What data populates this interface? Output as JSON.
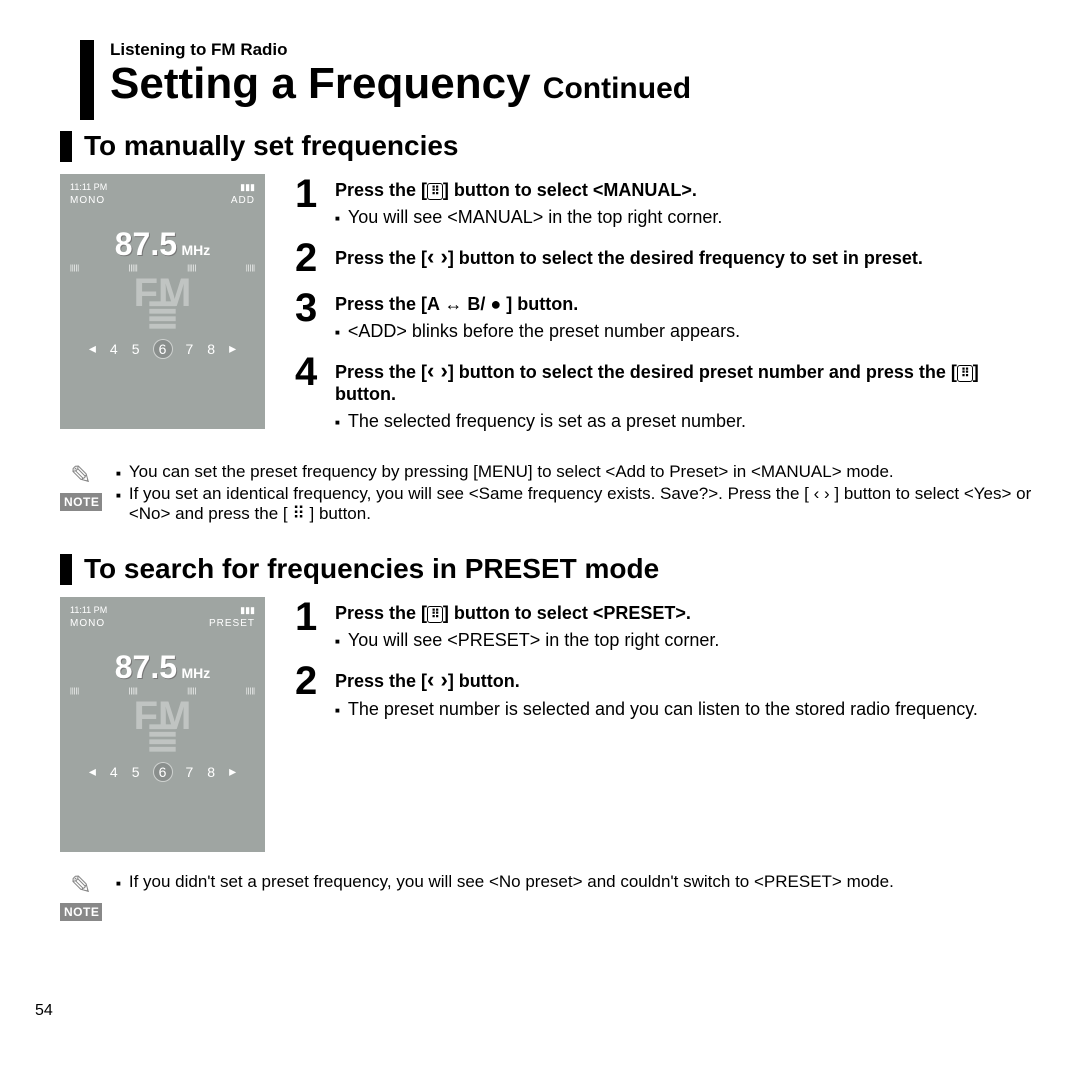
{
  "page_number": "54",
  "breadcrumb": "Listening to FM Radio",
  "title_main": "Setting a Frequency",
  "title_cont": "Continued",
  "section1": {
    "title": "To manually set frequencies",
    "device": {
      "time": "11:11 PM",
      "left": "MONO",
      "right": "ADD",
      "freq": "87.5",
      "unit": "MHz",
      "presets": [
        "4",
        "5",
        "6",
        "7",
        "8"
      ]
    },
    "steps": [
      {
        "n": "1",
        "head_a": "Press the [",
        "head_b": "] button to select <MANUAL>.",
        "bullets": [
          "You will see <MANUAL> in the top right corner."
        ]
      },
      {
        "n": "2",
        "head_a": "Press the [",
        "head_b": "] button to select the desired frequency to set in preset.",
        "chev": true,
        "bullets": []
      },
      {
        "n": "3",
        "head_full": "Press the [A ↔ B/ ● ] button.",
        "bullets": [
          "<ADD> blinks before the preset number appears."
        ]
      },
      {
        "n": "4",
        "head_a": "Press the [",
        "head_b": "] button to select the desired preset number and press the [",
        "head_c": "] button.",
        "chev": true,
        "bullets": [
          "The selected frequency is set as a preset number."
        ]
      }
    ],
    "notes": [
      "You can set the preset frequency by pressing [MENU] to select <Add to Preset> in <MANUAL> mode.",
      "If you set an identical frequency, you will see <Same frequency exists. Save?>. Press the [ ‹ › ] button to select <Yes> or <No> and press the [ ⠿ ] button."
    ]
  },
  "section2": {
    "title": "To search for frequencies in PRESET mode",
    "device": {
      "time": "11:11 PM",
      "left": "MONO",
      "right": "PRESET",
      "freq": "87.5",
      "unit": "MHz",
      "presets": [
        "4",
        "5",
        "6",
        "7",
        "8"
      ]
    },
    "steps": [
      {
        "n": "1",
        "head_a": "Press the [",
        "head_b": "] button to select <PRESET>.",
        "bullets": [
          "You will see <PRESET> in the top right corner."
        ]
      },
      {
        "n": "2",
        "head_a": "Press the [",
        "head_b": "] button.",
        "chev": true,
        "bullets": [
          "The preset number is selected and you can listen to the stored radio frequency."
        ]
      }
    ],
    "notes": [
      "If you didn't set a preset frequency, you will see <No preset> and couldn't switch to <PRESET> mode."
    ]
  },
  "note_label": "NOTE"
}
